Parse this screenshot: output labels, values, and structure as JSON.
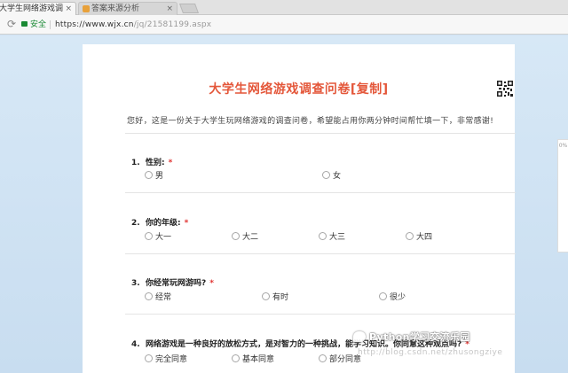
{
  "browser": {
    "tabs": [
      {
        "label": "大学生网络游戏调查问卷",
        "active": true
      },
      {
        "label": "答案来源分析",
        "active": false
      }
    ],
    "close_glyph": "×",
    "secure_label": "安全",
    "url_host": "https://www.wjx.cn",
    "url_path": "/jq/21581199.aspx"
  },
  "survey": {
    "title": "大学生网络游戏调查问卷[复制]",
    "intro": "您好，这是一份关于大学生玩网络游戏的调查问卷，希望能占用你两分钟时间帮忙填一下，非常感谢!",
    "required_mark": "*",
    "questions": [
      {
        "number": "1.",
        "text": "性别:",
        "required": true,
        "options": [
          "男",
          "女"
        ]
      },
      {
        "number": "2.",
        "text": "你的年级:",
        "required": true,
        "options": [
          "大一",
          "大二",
          "大三",
          "大四"
        ]
      },
      {
        "number": "3.",
        "text": "你经常玩网游吗?",
        "required": true,
        "options": [
          "经常",
          "有时",
          "很少"
        ]
      },
      {
        "number": "4.",
        "text": "网络游戏是一种良好的放松方式，是对智力的一种挑战，能学习知识。你同意这种观点吗?",
        "required": true,
        "options": [
          "完全同意",
          "基本同意",
          "部分同意"
        ]
      }
    ]
  },
  "side_tab_text": "0%",
  "watermark": {
    "text": "Python学习交流乐园",
    "url": "http://blog.csdn.net/zhusongziye"
  }
}
